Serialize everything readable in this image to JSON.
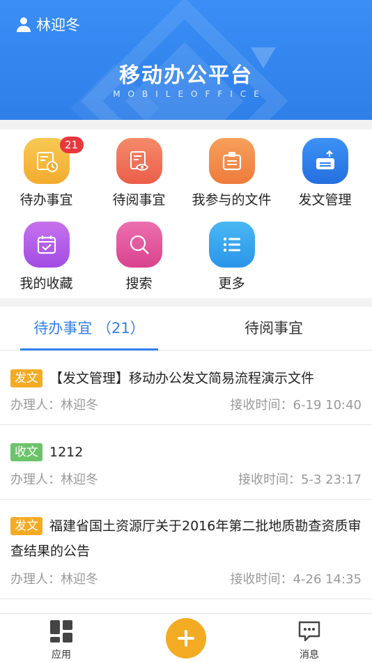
{
  "header": {
    "user_name": "林迎冬",
    "title": "移动办公平台",
    "subtitle": "MOBILEOFFICE"
  },
  "quick_actions": [
    {
      "label": "待办事宜",
      "icon": "todo-clock-icon",
      "badge": "21",
      "color": "#f5b93f"
    },
    {
      "label": "待阅事宜",
      "icon": "read-eye-icon",
      "color": "#ef6f55"
    },
    {
      "label": "我参与的文件",
      "icon": "participated-file-icon",
      "color": "#f28c48"
    },
    {
      "label": "发文管理",
      "icon": "outgoing-doc-icon",
      "color": "#2f7fe8"
    },
    {
      "label": "我的收藏",
      "icon": "calendar-check-icon",
      "color": "#b35ee8"
    },
    {
      "label": "搜索",
      "icon": "search-icon",
      "color": "#e2559b"
    },
    {
      "label": "更多",
      "icon": "list-more-icon",
      "color": "#38a7ef"
    }
  ],
  "tabs": [
    {
      "label": "待办事宜",
      "count": "（21）",
      "active": true
    },
    {
      "label": "待阅事宜",
      "active": false
    }
  ],
  "list": [
    {
      "tag": "发文",
      "tag_color": "#f4ab24",
      "title": "【发文管理】移动办公发文简易流程演示文件",
      "handler_label": "办理人：",
      "handler": "林迎冬",
      "time_label": "接收时间：",
      "time": "6-19 10:40"
    },
    {
      "tag": "收文",
      "tag_color": "#6cc36a",
      "title": "1212",
      "handler_label": "办理人：",
      "handler": "林迎冬",
      "time_label": "接收时间：",
      "time": "5-3 23:17"
    },
    {
      "tag": "发文",
      "tag_color": "#f4ab24",
      "title": "福建省国土资源厅关于2016年第二批地质勘查资质审查结果的公告",
      "handler_label": "办理人：",
      "handler": "林迎冬",
      "time_label": "接收时间：",
      "time": "4-26 14:35"
    }
  ],
  "bottom_nav": {
    "apps_label": "应用",
    "messages_label": "消息",
    "accent": "#f4ab24"
  }
}
